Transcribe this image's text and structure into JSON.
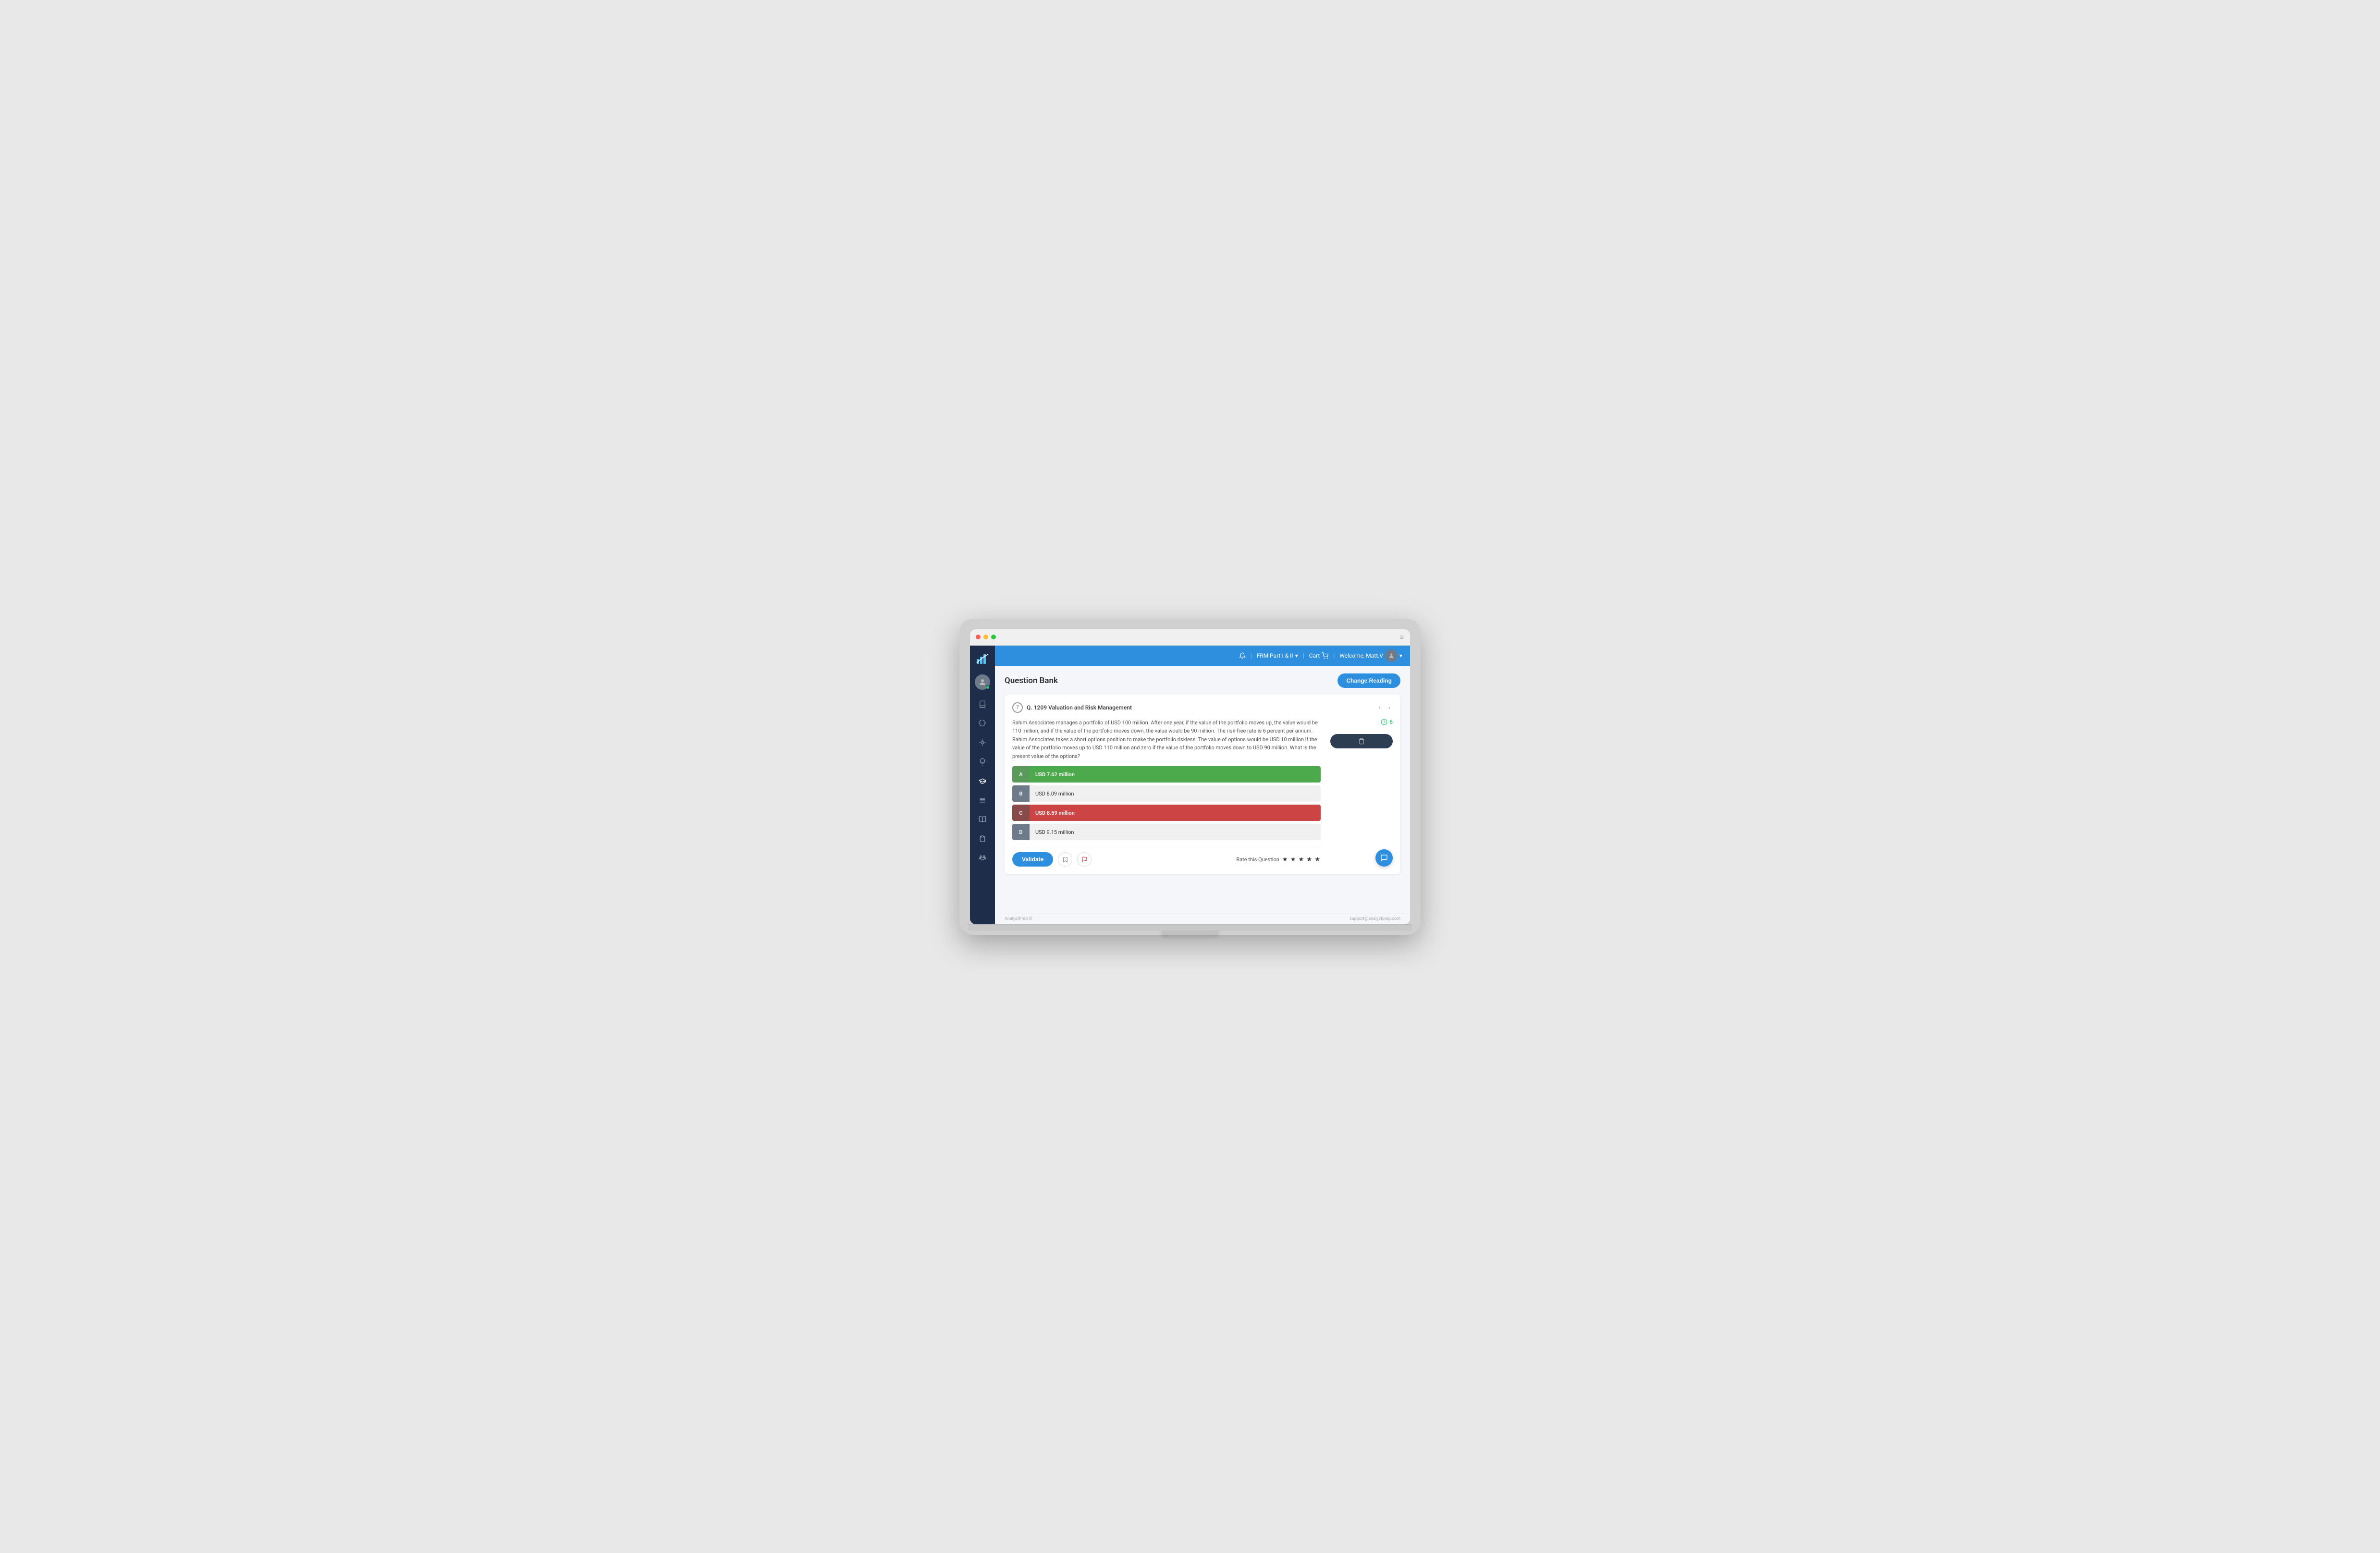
{
  "window": {
    "dots": [
      "red",
      "yellow",
      "green"
    ]
  },
  "topbar": {
    "bell_icon": "🔔",
    "exam_label": "FRM Part I & II",
    "cart_label": "Cart",
    "cart_icon": "🛒",
    "welcome_label": "Welcome, Matt.V",
    "dropdown_icon": "▾",
    "menu_icon": "≡"
  },
  "sidebar": {
    "logo_icon": "📊",
    "items": [
      {
        "name": "avatar",
        "icon": "👤"
      },
      {
        "name": "book-open",
        "icon": "📖"
      },
      {
        "name": "brain",
        "icon": "🧠"
      },
      {
        "name": "brain2",
        "icon": "🧠"
      },
      {
        "name": "lightbulb",
        "icon": "💡"
      },
      {
        "name": "graduation",
        "icon": "🎓"
      },
      {
        "name": "book-list",
        "icon": "📋"
      },
      {
        "name": "book2",
        "icon": "📕"
      },
      {
        "name": "clipboard",
        "icon": "📝"
      },
      {
        "name": "paw",
        "icon": "🐾"
      }
    ]
  },
  "page": {
    "title": "Question Bank",
    "change_reading_btn": "Change Reading"
  },
  "question": {
    "icon": "?",
    "label": "Q. 1209 Valuation and Risk Management",
    "body": "Rahim Associates manages a portfolio of USD 100 million. After one year, if the value of the portfolio moves up, the value would be 110 million, and if the value of the portfolio moves down, the value would be 90 million. The risk-free rate is 6 percent per annum. Rahim Associates takes a short options position to make the portfolio riskless. The value of options would be USD 10 million if the value of the portfolio moves up to USD 110 million and zero if the value of the portfolio moves down to USD 90 million. What is the present value of the options?",
    "timer_value": "6",
    "options": [
      {
        "letter": "A",
        "text": "USD 7.62 million",
        "state": "correct"
      },
      {
        "letter": "B",
        "text": "USD 8.09 million",
        "state": "normal"
      },
      {
        "letter": "C",
        "text": "USD 8.59 million",
        "state": "wrong"
      },
      {
        "letter": "D",
        "text": "USD 9.15 million",
        "state": "normal"
      }
    ],
    "validate_btn": "Validate",
    "bookmark_icon": "🔖",
    "flag_icon": "🚩",
    "rate_label": "Rate this Question",
    "stars": "★ ★ ★ ★ ★"
  },
  "footer": {
    "copyright": "AnalystPrep ©",
    "support": "support@analystprep.com"
  }
}
